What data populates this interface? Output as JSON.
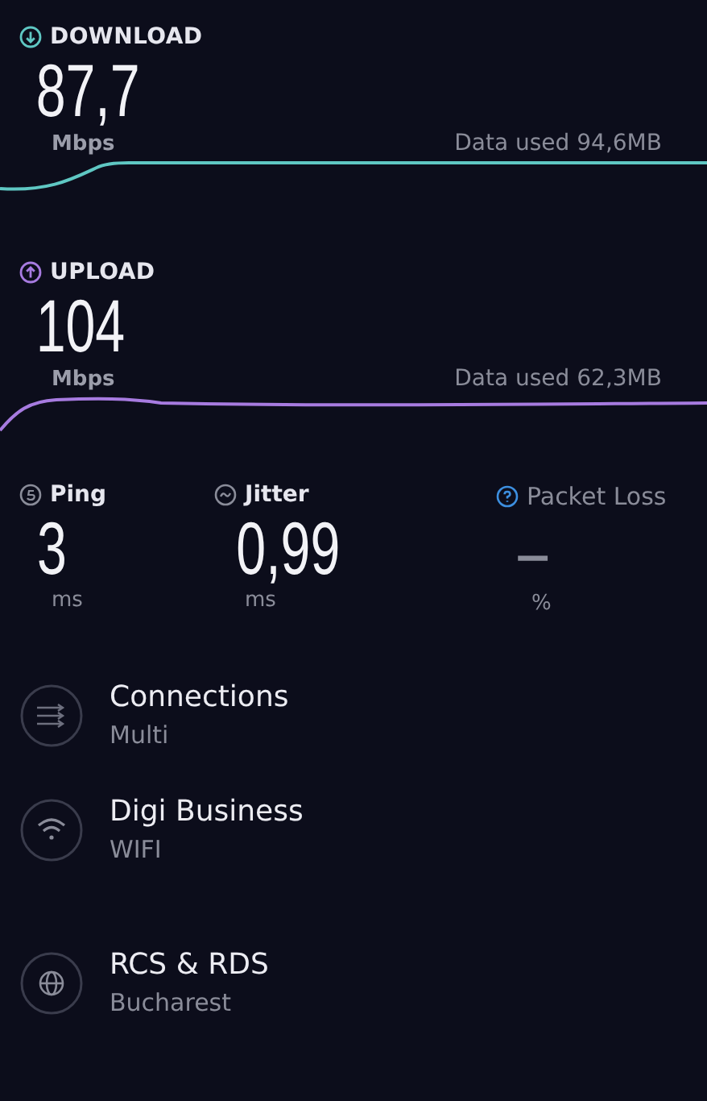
{
  "speeds": [
    {
      "kind": "download",
      "label": "DOWNLOAD",
      "value": "87,7",
      "unit": "Mbps",
      "data_used": "Data used 94,6MB",
      "color": "#5fc7c3"
    },
    {
      "kind": "upload",
      "label": "UPLOAD",
      "value": "104",
      "unit": "Mbps",
      "data_used": "Data used 62,3MB",
      "color": "#a77be0"
    }
  ],
  "metrics": [
    {
      "kind": "ping",
      "label": "Ping",
      "value": "3",
      "unit": "ms",
      "color": "#8a8c99"
    },
    {
      "kind": "jitter",
      "label": "Jitter",
      "value": "0,99",
      "unit": "ms",
      "color": "#8a8c99"
    },
    {
      "kind": "packet_loss",
      "label": "Packet Loss",
      "value": "–",
      "unit": "%",
      "color": "#3d8fe0"
    }
  ],
  "details": [
    {
      "kind": "connections",
      "title": "Connections",
      "subtitle": "Multi"
    },
    {
      "kind": "wifi",
      "title": "Digi Business",
      "subtitle": "WIFI"
    },
    {
      "kind": "globe",
      "title": "RCS & RDS",
      "subtitle": "Bucharest"
    }
  ]
}
